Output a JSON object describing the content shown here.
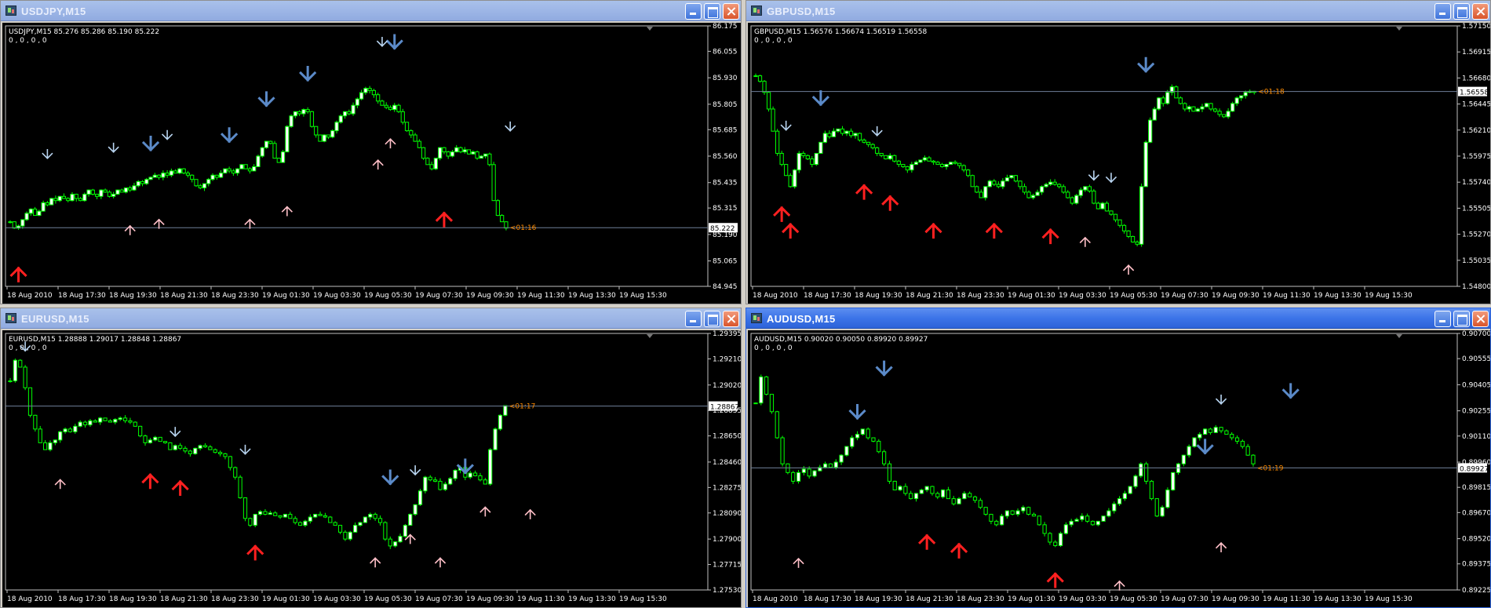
{
  "colors": {
    "background": "#000000",
    "candle_bull_body": "#ffffff",
    "candle_bear_body": "#000000",
    "wick": "#00ff00",
    "grid_border": "#c0c0c0",
    "price_line": "#6f7f99",
    "big_up_arrow": "#ff2020",
    "small_up_arrow": "#ffc0c8",
    "big_down_arrow": "#5b8ac8",
    "small_down_arrow": "#b8d4f0",
    "countdown": "#ff8c00"
  },
  "windows": [
    {
      "title": "USDJPY,M15",
      "active": false,
      "info": "USDJPY,M15  85.276 85.286 85.190 85.222",
      "indicator": "0 , 0 , 0 , 0",
      "y_labels": [
        "86.175",
        "86.055",
        "85.930",
        "85.805",
        "85.685",
        "85.560",
        "85.435",
        "85.315",
        "85.190",
        "85.065",
        "84.945"
      ],
      "x_labels": [
        "18 Aug 2010",
        "18 Aug 17:30",
        "18 Aug 19:30",
        "18 Aug 21:30",
        "18 Aug 23:30",
        "19 Aug 01:30",
        "19 Aug 03:30",
        "19 Aug 05:30",
        "19 Aug 07:30",
        "19 Aug 09:30",
        "19 Aug 11:30",
        "19 Aug 13:30",
        "19 Aug 15:30"
      ],
      "price_tag": "85.222",
      "countdown": "<01:16",
      "chart_data": {
        "type": "candlestick",
        "ylim": [
          84.945,
          86.175
        ],
        "bars": 126,
        "current_price": 85.222,
        "closes": [
          85.25,
          85.22,
          85.23,
          85.26,
          85.29,
          85.31,
          85.28,
          85.3,
          85.34,
          85.33,
          85.36,
          85.35,
          85.37,
          85.36,
          85.35,
          85.38,
          85.36,
          85.35,
          85.38,
          85.4,
          85.38,
          85.37,
          85.4,
          85.39,
          85.37,
          85.38,
          85.4,
          85.39,
          85.41,
          85.4,
          85.42,
          85.44,
          85.43,
          85.45,
          85.46,
          85.47,
          85.46,
          85.48,
          85.47,
          85.49,
          85.48,
          85.5,
          85.48,
          85.47,
          85.45,
          85.42,
          85.41,
          85.43,
          85.45,
          85.47,
          85.46,
          85.48,
          85.5,
          85.49,
          85.48,
          85.5,
          85.52,
          85.5,
          85.49,
          85.51,
          85.56,
          85.6,
          85.63,
          85.62,
          85.55,
          85.53,
          85.58,
          85.7,
          85.75,
          85.77,
          85.76,
          85.78,
          85.77,
          85.7,
          85.66,
          85.63,
          85.66,
          85.65,
          85.68,
          85.72,
          85.75,
          85.77,
          85.76,
          85.8,
          85.83,
          85.86,
          85.88,
          85.87,
          85.85,
          85.82,
          85.8,
          85.79,
          85.78,
          85.8,
          85.77,
          85.72,
          85.68,
          85.66,
          85.63,
          85.6,
          85.55,
          85.52,
          85.5,
          85.55,
          85.6,
          85.58,
          85.56,
          85.58,
          85.6,
          85.58,
          85.59,
          85.57,
          85.58,
          85.55,
          85.56,
          85.57,
          85.52,
          85.35,
          85.28,
          85.25,
          85.22
        ],
        "up_arrows_big": [
          {
            "bar": 2,
            "price": 85.0
          },
          {
            "bar": 105,
            "price": 85.26
          }
        ],
        "up_arrows_small": [
          {
            "bar": 29,
            "price": 85.21
          },
          {
            "bar": 36,
            "price": 85.24
          },
          {
            "bar": 58,
            "price": 85.24
          },
          {
            "bar": 67,
            "price": 85.3
          },
          {
            "bar": 89,
            "price": 85.52
          },
          {
            "bar": 92,
            "price": 85.62
          }
        ],
        "down_arrows_big": [
          {
            "bar": 34,
            "price": 85.62
          },
          {
            "bar": 53,
            "price": 85.66
          },
          {
            "bar": 62,
            "price": 85.83
          },
          {
            "bar": 72,
            "price": 85.95
          },
          {
            "bar": 93,
            "price": 86.1
          }
        ],
        "down_arrows_small": [
          {
            "bar": 9,
            "price": 85.57
          },
          {
            "bar": 25,
            "price": 85.6
          },
          {
            "bar": 38,
            "price": 85.66
          },
          {
            "bar": 90,
            "price": 86.1
          },
          {
            "bar": 121,
            "price": 85.7
          }
        ]
      }
    },
    {
      "title": "GBPUSD,M15",
      "active": false,
      "info": "GBPUSD,M15  1.56576 1.56674 1.56519 1.56558",
      "indicator": "0 , 0 , 0 , 0",
      "y_labels": [
        "1.57150",
        "1.56915",
        "1.56680",
        "1.56445",
        "1.56210",
        "1.55975",
        "1.55740",
        "1.55505",
        "1.55270",
        "1.55035",
        "1.54800"
      ],
      "x_labels": [
        "18 Aug 2010",
        "18 Aug 17:30",
        "18 Aug 19:30",
        "18 Aug 21:30",
        "18 Aug 23:30",
        "19 Aug 01:30",
        "19 Aug 03:30",
        "19 Aug 05:30",
        "19 Aug 07:30",
        "19 Aug 09:30",
        "19 Aug 11:30",
        "19 Aug 13:30",
        "19 Aug 15:30"
      ],
      "price_tag": "1.56558",
      "countdown": "<01:18",
      "chart_data": {
        "type": "candlestick",
        "ylim": [
          1.548,
          1.5715
        ],
        "bars": 126,
        "current_price": 1.56558,
        "closes": [
          1.567,
          1.5665,
          1.5655,
          1.564,
          1.562,
          1.56,
          1.559,
          1.558,
          1.557,
          1.5585,
          1.56,
          1.5598,
          1.5595,
          1.559,
          1.56,
          1.561,
          1.5618,
          1.5615,
          1.562,
          1.5622,
          1.5618,
          1.562,
          1.5616,
          1.5618,
          1.5612,
          1.561,
          1.5608,
          1.5605,
          1.56,
          1.5598,
          1.5595,
          1.5598,
          1.5593,
          1.559,
          1.5588,
          1.5585,
          1.559,
          1.5592,
          1.5594,
          1.5596,
          1.5593,
          1.5592,
          1.559,
          1.5588,
          1.559,
          1.5592,
          1.5591,
          1.5589,
          1.5585,
          1.558,
          1.557,
          1.5565,
          1.556,
          1.557,
          1.5575,
          1.5572,
          1.557,
          1.5575,
          1.5578,
          1.558,
          1.5575,
          1.557,
          1.5565,
          1.556,
          1.5562,
          1.5565,
          1.557,
          1.5572,
          1.5574,
          1.5572,
          1.557,
          1.5565,
          1.556,
          1.5555,
          1.5562,
          1.5567,
          1.557,
          1.5566,
          1.5555,
          1.555,
          1.5555,
          1.5548,
          1.5545,
          1.554,
          1.5535,
          1.553,
          1.5525,
          1.552,
          1.5518,
          1.557,
          1.561,
          1.563,
          1.564,
          1.565,
          1.5645,
          1.5655,
          1.566,
          1.565,
          1.5645,
          1.564,
          1.5642,
          1.5638,
          1.564,
          1.5642,
          1.5645,
          1.564,
          1.5638,
          1.5635,
          1.5633,
          1.5638,
          1.5645,
          1.565,
          1.5652,
          1.5655,
          1.5656,
          1.5655
        ],
        "up_arrows_big": [
          {
            "bar": 6,
            "price": 1.5545
          },
          {
            "bar": 8,
            "price": 1.553
          },
          {
            "bar": 25,
            "price": 1.5565
          },
          {
            "bar": 31,
            "price": 1.5555
          },
          {
            "bar": 41,
            "price": 1.553
          },
          {
            "bar": 55,
            "price": 1.553
          },
          {
            "bar": 68,
            "price": 1.5525
          }
        ],
        "up_arrows_small": [
          {
            "bar": 76,
            "price": 1.552
          },
          {
            "bar": 86,
            "price": 1.5495
          }
        ],
        "down_arrows_big": [
          {
            "bar": 15,
            "price": 1.565
          },
          {
            "bar": 90,
            "price": 1.568
          }
        ],
        "down_arrows_small": [
          {
            "bar": 7,
            "price": 1.5625
          },
          {
            "bar": 28,
            "price": 1.562
          },
          {
            "bar": 78,
            "price": 1.558
          },
          {
            "bar": 82,
            "price": 1.5578
          }
        ]
      }
    },
    {
      "title": "EURUSD,M15",
      "active": false,
      "info": "EURUSD,M15  1.28888 1.29017 1.28848 1.28867",
      "indicator": "0 , 0 , 0 , 0",
      "y_labels": [
        "1.29395",
        "1.29210",
        "1.29020",
        "1.28835",
        "1.28650",
        "1.28460",
        "1.28275",
        "1.28090",
        "1.27900",
        "1.27715",
        "1.27530"
      ],
      "x_labels": [
        "18 Aug 2010",
        "18 Aug 17:30",
        "18 Aug 19:30",
        "18 Aug 21:30",
        "18 Aug 23:30",
        "19 Aug 01:30",
        "19 Aug 03:30",
        "19 Aug 05:30",
        "19 Aug 07:30",
        "19 Aug 09:30",
        "19 Aug 11:30",
        "19 Aug 13:30",
        "19 Aug 15:30"
      ],
      "price_tag": "1.28867",
      "countdown": "<01:17",
      "chart_data": {
        "type": "candlestick",
        "ylim": [
          1.2753,
          1.29395
        ],
        "bars": 126,
        "current_price": 1.28867,
        "closes": [
          1.2905,
          1.292,
          1.2915,
          1.29,
          1.288,
          1.287,
          1.286,
          1.2855,
          1.286,
          1.2862,
          1.2868,
          1.287,
          1.2868,
          1.2872,
          1.2875,
          1.2873,
          1.2876,
          1.2875,
          1.2878,
          1.2876,
          1.2875,
          1.2877,
          1.2878,
          1.2876,
          1.2875,
          1.2872,
          1.2865,
          1.286,
          1.2862,
          1.2864,
          1.2861,
          1.286,
          1.2855,
          1.2858,
          1.2856,
          1.2854,
          1.2852,
          1.2856,
          1.2858,
          1.2857,
          1.2855,
          1.2853,
          1.2852,
          1.285,
          1.2842,
          1.2835,
          1.282,
          1.2805,
          1.28,
          1.2808,
          1.281,
          1.2808,
          1.2809,
          1.2807,
          1.2806,
          1.2808,
          1.2805,
          1.2802,
          1.28,
          1.2803,
          1.2806,
          1.2808,
          1.2807,
          1.2806,
          1.2802,
          1.28,
          1.2795,
          1.279,
          1.2795,
          1.28,
          1.2802,
          1.2806,
          1.2808,
          1.2805,
          1.2802,
          1.279,
          1.2785,
          1.2788,
          1.2792,
          1.28,
          1.2808,
          1.2815,
          1.2825,
          1.2835,
          1.2833,
          1.2832,
          1.2826,
          1.283,
          1.2834,
          1.284,
          1.2842,
          1.2835,
          1.2838,
          1.2836,
          1.2833,
          1.283,
          1.2855,
          1.287,
          1.288,
          1.2887
        ],
        "up_arrows_big": [
          {
            "bar": 28,
            "price": 1.2832
          },
          {
            "bar": 34,
            "price": 1.2827
          },
          {
            "bar": 49,
            "price": 1.278
          }
        ],
        "up_arrows_small": [
          {
            "bar": 10,
            "price": 1.283
          },
          {
            "bar": 73,
            "price": 1.2773
          },
          {
            "bar": 80,
            "price": 1.279
          },
          {
            "bar": 86,
            "price": 1.2773
          },
          {
            "bar": 95,
            "price": 1.281
          },
          {
            "bar": 104,
            "price": 1.2808
          }
        ],
        "down_arrows_big": [
          {
            "bar": 76,
            "price": 1.2835
          },
          {
            "bar": 91,
            "price": 1.2843
          }
        ],
        "down_arrows_small": [
          {
            "bar": 3,
            "price": 1.293
          },
          {
            "bar": 33,
            "price": 1.2868
          },
          {
            "bar": 47,
            "price": 1.2855
          },
          {
            "bar": 81,
            "price": 1.284
          }
        ]
      }
    },
    {
      "title": "AUDUSD,M15",
      "active": true,
      "info": "AUDUSD,M15  0.90020 0.90050 0.89920 0.89927",
      "indicator": "0 , 0 , 0 , 0",
      "y_labels": [
        "0.90700",
        "0.90555",
        "0.90405",
        "0.90255",
        "0.90110",
        "0.89960",
        "0.89815",
        "0.89670",
        "0.89520",
        "0.89375",
        "0.89225"
      ],
      "x_labels": [
        "18 Aug 2010",
        "18 Aug 17:30",
        "18 Aug 19:30",
        "18 Aug 21:30",
        "18 Aug 23:30",
        "19 Aug 01:30",
        "19 Aug 03:30",
        "19 Aug 05:30",
        "19 Aug 07:30",
        "19 Aug 09:30",
        "19 Aug 11:30",
        "19 Aug 13:30",
        "19 Aug 15:30"
      ],
      "price_tag": "0.89927",
      "countdown": "<01:19",
      "chart_data": {
        "type": "candlestick",
        "ylim": [
          0.89225,
          0.907
        ],
        "bars": 126,
        "current_price": 0.89927,
        "closes": [
          0.903,
          0.9045,
          0.9035,
          0.9025,
          0.901,
          0.8995,
          0.899,
          0.8985,
          0.899,
          0.8992,
          0.8988,
          0.8991,
          0.8993,
          0.8995,
          0.8993,
          0.8996,
          0.9,
          0.9005,
          0.901,
          0.9012,
          0.9015,
          0.901,
          0.9008,
          0.9002,
          0.8995,
          0.8985,
          0.898,
          0.8982,
          0.8978,
          0.8975,
          0.8978,
          0.898,
          0.8982,
          0.8978,
          0.8976,
          0.898,
          0.8975,
          0.8972,
          0.8975,
          0.8978,
          0.8976,
          0.8974,
          0.897,
          0.8966,
          0.8962,
          0.896,
          0.8965,
          0.8968,
          0.8966,
          0.8968,
          0.897,
          0.8966,
          0.8965,
          0.896,
          0.8955,
          0.895,
          0.8948,
          0.8955,
          0.896,
          0.8962,
          0.8963,
          0.8965,
          0.8962,
          0.896,
          0.8962,
          0.8965,
          0.8968,
          0.8972,
          0.8975,
          0.8978,
          0.8982,
          0.8988,
          0.8995,
          0.8985,
          0.8975,
          0.8965,
          0.897,
          0.898,
          0.899,
          0.8995,
          0.9,
          0.9005,
          0.901,
          0.9012,
          0.9015,
          0.9013,
          0.9016,
          0.9014,
          0.9012,
          0.901,
          0.9008,
          0.9005,
          0.9,
          0.8995
        ],
        "up_arrows_big": [
          {
            "bar": 32,
            "price": 0.895
          },
          {
            "bar": 38,
            "price": 0.8945
          },
          {
            "bar": 56,
            "price": 0.8928
          }
        ],
        "up_arrows_small": [
          {
            "bar": 8,
            "price": 0.8938
          },
          {
            "bar": 68,
            "price": 0.8925
          },
          {
            "bar": 87,
            "price": 0.8947
          }
        ],
        "down_arrows_big": [
          {
            "bar": 19,
            "price": 0.9025
          },
          {
            "bar": 24,
            "price": 0.905
          },
          {
            "bar": 84,
            "price": 0.9005
          },
          {
            "bar": 100,
            "price": 0.9037
          }
        ],
        "down_arrows_small": [
          {
            "bar": 87,
            "price": 0.9032
          }
        ]
      }
    }
  ]
}
